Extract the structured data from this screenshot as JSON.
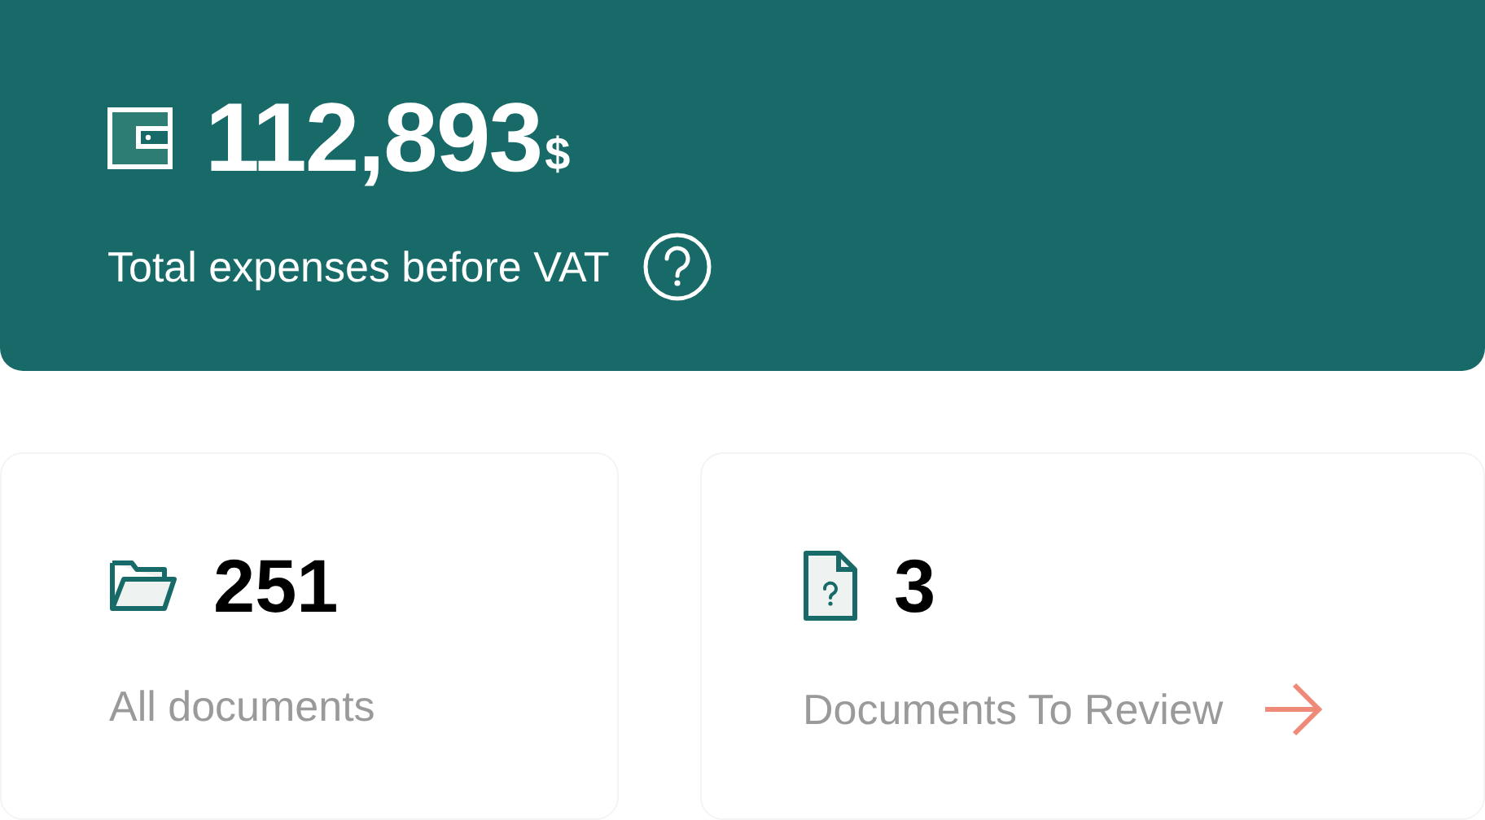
{
  "total": {
    "amount": "112,893",
    "currency": "$",
    "label": "Total expenses before VAT"
  },
  "stats": [
    {
      "kind": "folder",
      "count": "251",
      "label": "All documents",
      "link": false
    },
    {
      "kind": "review",
      "count": "3",
      "label": "Documents To Review",
      "link": true
    }
  ]
}
